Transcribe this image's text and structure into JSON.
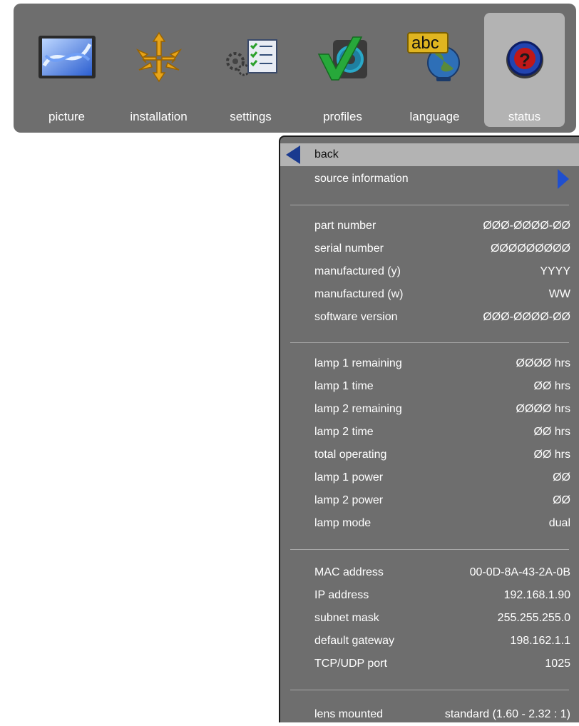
{
  "tabs": [
    {
      "label": "picture",
      "icon": "picture-icon"
    },
    {
      "label": "installation",
      "icon": "installation-icon"
    },
    {
      "label": "settings",
      "icon": "settings-icon"
    },
    {
      "label": "profiles",
      "icon": "profiles-icon"
    },
    {
      "label": "language",
      "icon": "language-icon"
    },
    {
      "label": "status",
      "icon": "status-help-icon",
      "selected": true
    }
  ],
  "language_icon_text": "abc",
  "status_icon_text": "?",
  "menu": {
    "back": "back",
    "source_information": "source information",
    "group1": [
      {
        "k": "part number",
        "v": "ØØØ-ØØØØ-ØØ"
      },
      {
        "k": "serial number",
        "v": "ØØØØØØØØØ"
      },
      {
        "k": "manufactured (y)",
        "v": "YYYY"
      },
      {
        "k": "manufactured (w)",
        "v": "WW"
      },
      {
        "k": "software version",
        "v": "ØØØ-ØØØØ-ØØ"
      }
    ],
    "group2": [
      {
        "k": "lamp 1 remaining",
        "v": "ØØØØ hrs"
      },
      {
        "k": "lamp 1 time",
        "v": "ØØ hrs"
      },
      {
        "k": "lamp 2 remaining",
        "v": "ØØØØ hrs"
      },
      {
        "k": "lamp 2 time",
        "v": "ØØ hrs"
      },
      {
        "k": "total operating",
        "v": "ØØ hrs"
      },
      {
        "k": "lamp 1 power",
        "v": "ØØ"
      },
      {
        "k": "lamp 2 power",
        "v": "ØØ"
      },
      {
        "k": "lamp mode",
        "v": "dual"
      }
    ],
    "group3": [
      {
        "k": "MAC address",
        "v": "00-0D-8A-43-2A-0B"
      },
      {
        "k": "IP address",
        "v": "192.168.1.90"
      },
      {
        "k": "subnet mask",
        "v": "255.255.255.0"
      },
      {
        "k": "default gateway",
        "v": "198.162.1.1"
      },
      {
        "k": "TCP/UDP port",
        "v": "1025"
      }
    ],
    "group4": [
      {
        "k": "lens mounted",
        "v": "standard (1.60 - 2.32 : 1)"
      }
    ]
  },
  "colors": {
    "bar_bg": "#6e6e6e",
    "selected_bg": "#b3b3b3",
    "arrow_blue": "#1f4fcf"
  }
}
